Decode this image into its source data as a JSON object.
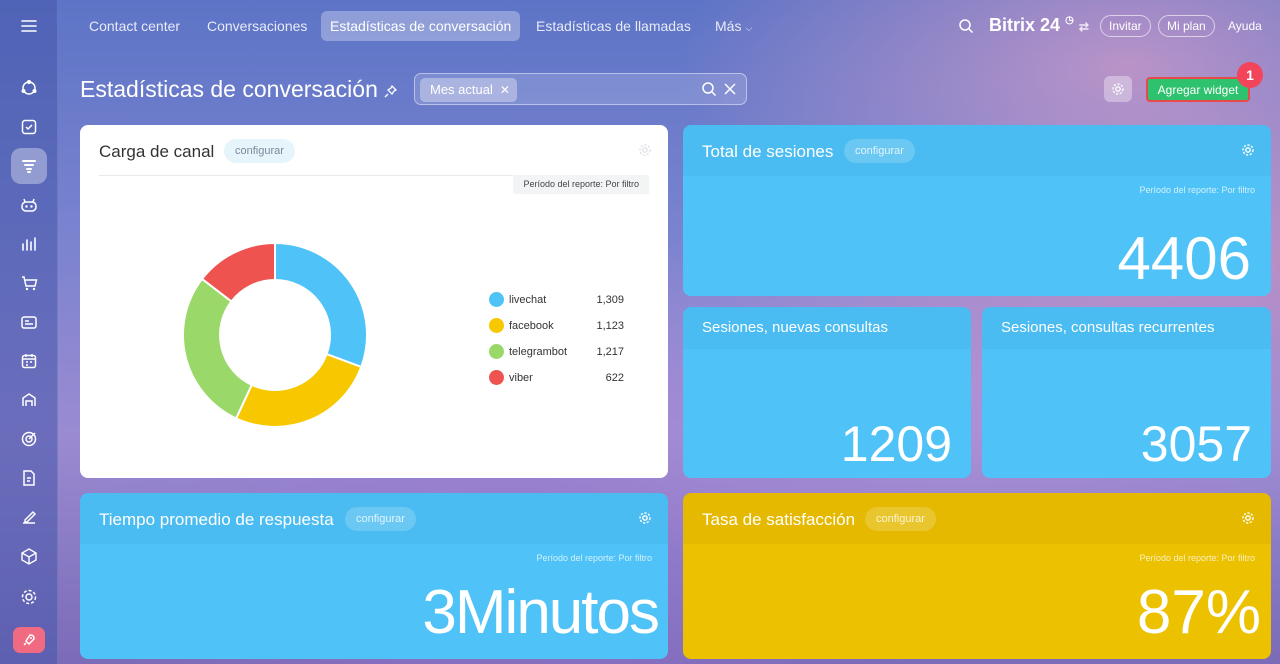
{
  "nav": {
    "tabs": [
      {
        "label": "Contact center"
      },
      {
        "label": "Conversaciones"
      },
      {
        "label": "Estadísticas de conversación"
      },
      {
        "label": "Estadísticas de llamadas"
      },
      {
        "label": "Más"
      }
    ],
    "brand": "Bitrix 24",
    "invite_label": "Invitar",
    "plan_label": "Mi plan",
    "help_label": "Ayuda"
  },
  "page": {
    "title": "Estadísticas de conversación",
    "filter_chip": "Mes actual",
    "add_widget_label": "Agregar widget",
    "badge": "1"
  },
  "widgets": {
    "channel_load": {
      "title": "Carga de canal",
      "configure": "configurar",
      "period": "Período del reporte: Por filtro"
    },
    "total_sessions": {
      "title": "Total de sesiones",
      "configure": "configurar",
      "period": "Período del reporte: Por filtro",
      "value": "4406"
    },
    "new_sessions": {
      "title": "Sesiones, nuevas consultas",
      "value": "1209"
    },
    "recurring_sessions": {
      "title": "Sesiones, consultas recurrentes",
      "value": "3057"
    },
    "response_time": {
      "title": "Tiempo promedio de respuesta",
      "configure": "configurar",
      "period": "Período del reporte: Por filtro",
      "value": "3Minutos"
    },
    "satisfaction": {
      "title": "Tasa de satisfacción",
      "configure": "configurar",
      "period": "Período del reporte: Por filtro",
      "value": "87%"
    }
  },
  "chart_data": {
    "type": "pie",
    "categories": [
      "livechat",
      "facebook",
      "telegrambot",
      "viber"
    ],
    "values": [
      1309,
      1123,
      1217,
      622
    ],
    "value_labels": [
      "1,309",
      "1,123",
      "1,217",
      "622"
    ],
    "colors": [
      "#4fc3f7",
      "#f7c800",
      "#9bd86a",
      "#ef5350"
    ],
    "legend": "right"
  },
  "colors": {
    "accent_green": "#2fc26e",
    "widget_blue": "#4fc3f7",
    "widget_yellow": "#ecc100",
    "badge_red": "#f2445a"
  }
}
